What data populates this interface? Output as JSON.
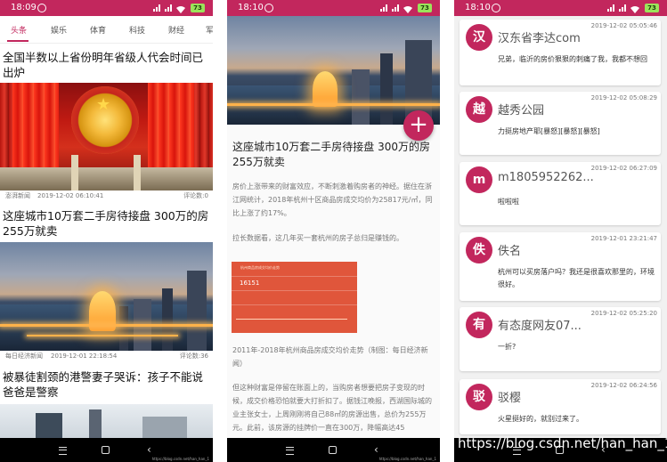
{
  "phone1": {
    "status": {
      "time": "18:09",
      "battery": "73"
    },
    "tabs": [
      "头条",
      "娱乐",
      "体育",
      "科技",
      "财经",
      "军"
    ],
    "active_tab": 0,
    "news": [
      {
        "title": "全国半数以上省份明年省级人代会时间已出炉",
        "source": "澎湃新闻",
        "time": "2019-12-02 06:10:41",
        "comments": "评论数:0"
      },
      {
        "title": "这座城市10万套二手房待接盘 300万的房255万就卖",
        "source": "每日经济新闻",
        "time": "2019-12-01 22:18:54",
        "comments": "评论数:36"
      },
      {
        "title": "被暴徒割颈的港警妻子哭诉：孩子不能说爸爸是警察"
      }
    ]
  },
  "phone2": {
    "status": {
      "time": "18:10",
      "battery": "73"
    },
    "fab": "+",
    "article": {
      "title": "这座城市10万套二手房待接盘 300万的房255万就卖",
      "p1": "房价上涨带来的财富效应，不断刺激着购房者的神经。据住在浙江网统计，2018年杭州十区商品房成交均价为25817元/㎡，同比上涨了约17%。",
      "p2": "拉长数据看，这几年买一套杭州的房子总归是赚钱的。",
      "chart_title": "杭州商品房成交均价走势",
      "chart_value": "16151",
      "caption": "2011年-2018年杭州商品房成交均价走势（制图：每日经济新闻）",
      "p3": "但这种财富是停留在账面上的，当购房者想要把房子变现的时候，成交价格恐怕就要大打折扣了。据钱江晚报，西湖国际城的业主张女士，上周刚刚将自己88㎡的房源出售，总价为255万元。此前，该房源的挂牌价一直在300万，降幅高达45"
    }
  },
  "phone3": {
    "status": {
      "time": "18:10",
      "battery": "73"
    },
    "comments": [
      {
        "avatar": "汉",
        "name": "汉东省李达com",
        "time": "2019-12-02 05:05:46",
        "body": "兄弟，临沂的房价狠狠的刺痛了我，我都不想回"
      },
      {
        "avatar": "越",
        "name": "越秀公园",
        "time": "2019-12-02 05:08:29",
        "body": "力挺房地产耶[暴怒][暴怒][暴怒]"
      },
      {
        "avatar": "m",
        "name": "m1805952262...",
        "time": "2019-12-02 06:27:09",
        "body": "啦啦啦"
      },
      {
        "avatar": "佚",
        "name": "佚名",
        "time": "2019-12-01 23:21:47",
        "body": "杭州可以买房落户吗？我还是很喜欢那里的，环境很好。"
      },
      {
        "avatar": "有",
        "name": "有态度网友07...",
        "time": "2019-12-02 05:25:20",
        "body": "一折?"
      },
      {
        "avatar": "驳",
        "name": "驳樱",
        "time": "2019-12-02 06:24:56",
        "body": "火星挺好的，就别过来了。"
      }
    ]
  },
  "navbar": {
    "watermark": "https://blog.csdn.net/han_han_1"
  },
  "overlay_watermark": "https://blog.csdn.net/han_han_1",
  "colors": {
    "accent": "#c2275d",
    "navbar": "#000000"
  }
}
